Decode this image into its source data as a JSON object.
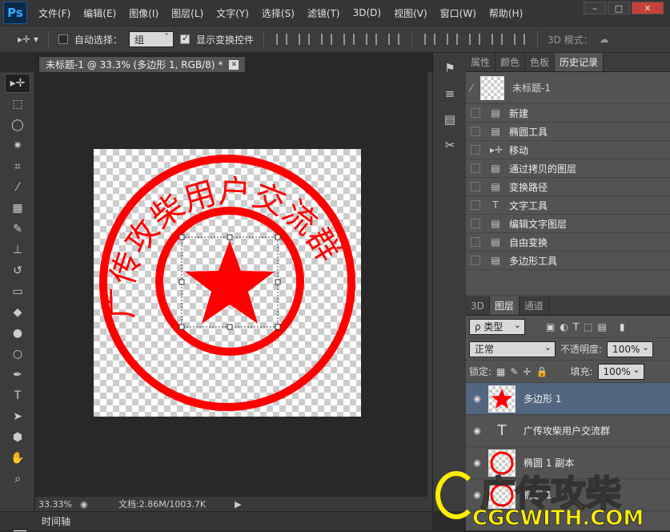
{
  "app": {
    "logo": "Ps"
  },
  "menu": [
    "文件(F)",
    "编辑(E)",
    "图像(I)",
    "图层(L)",
    "文字(Y)",
    "选择(S)",
    "滤镜(T)",
    "3D(D)",
    "视图(V)",
    "窗口(W)",
    "帮助(H)"
  ],
  "options": {
    "auto_select_label": "自动选择：",
    "auto_select_value": "组",
    "show_transform_label": "显示变换控件",
    "mode3d_label": "3D 模式："
  },
  "document": {
    "tab_title": "未标题-1 @ 33.3% (多边形 1, RGB/8) *",
    "zoom": "33.33%",
    "doc_info": "文档:2.86M/1003.7K"
  },
  "stamp": {
    "text": "广传攻柴用户交流群",
    "color": "#ff0000"
  },
  "panels": {
    "top_tabs": [
      "属性",
      "颜色",
      "色板",
      "历史记录"
    ],
    "history_snapshot": "未标题-1",
    "history": [
      {
        "icon": "doc-icon",
        "label": "新建"
      },
      {
        "icon": "doc-icon",
        "label": "椭圆工具"
      },
      {
        "icon": "move-icon",
        "label": "移动"
      },
      {
        "icon": "doc-icon",
        "label": "通过拷贝的图层"
      },
      {
        "icon": "doc-icon",
        "label": "变换路径"
      },
      {
        "icon": "type-icon",
        "label": "文字工具"
      },
      {
        "icon": "doc-icon",
        "label": "编辑文字图层"
      },
      {
        "icon": "doc-icon",
        "label": "自由变换"
      },
      {
        "icon": "doc-icon",
        "label": "多边形工具"
      }
    ],
    "layer_tabs": [
      "3D",
      "图层",
      "通道"
    ],
    "filter_label": "ρ 类型",
    "blend_mode": "正常",
    "opacity_label": "不透明度:",
    "opacity_value": "100%",
    "lock_label": "锁定:",
    "fill_label": "填充:",
    "fill_value": "100%",
    "layers": [
      {
        "name": "多边形 1",
        "kind": "shape-star",
        "selected": true
      },
      {
        "name": "广传攻柴用户交流群",
        "kind": "text",
        "selected": false
      },
      {
        "name": "椭圆 1 副本",
        "kind": "shape-circle",
        "selected": false
      },
      {
        "name": "椭圆 1",
        "kind": "shape-circle",
        "selected": false
      }
    ]
  },
  "timeline_label": "时间轴",
  "watermark": {
    "line1": "广传攻柴",
    "line2": "CGCWITH.COM"
  }
}
